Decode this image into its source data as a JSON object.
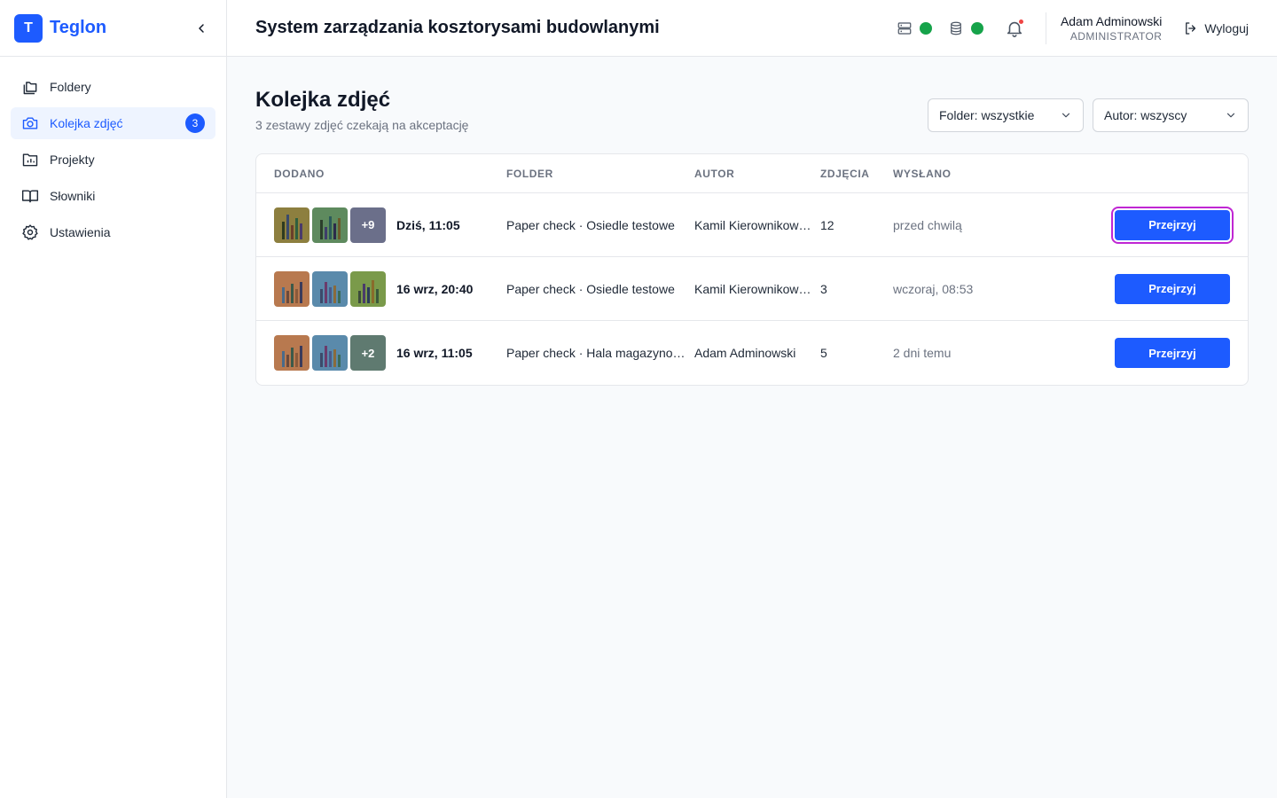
{
  "brand": {
    "logo_letter": "T",
    "name": "Teglon"
  },
  "nav": [
    {
      "label": "Foldery",
      "icon": "folders-icon",
      "active": false
    },
    {
      "label": "Kolejka zdjęć",
      "icon": "camera-icon",
      "active": true,
      "badge": "3"
    },
    {
      "label": "Projekty",
      "icon": "folder-chart-icon",
      "active": false
    },
    {
      "label": "Słowniki",
      "icon": "book-icon",
      "active": false
    },
    {
      "label": "Ustawienia",
      "icon": "gear-icon",
      "active": false
    }
  ],
  "header": {
    "title": "System zarządzania kosztorysami budowlanymi",
    "status": [
      {
        "icon": "server-icon",
        "color": "#16a34a"
      },
      {
        "icon": "database-icon",
        "color": "#16a34a"
      }
    ],
    "user": {
      "name": "Adam Adminowski",
      "role": "ADMINISTRATOR"
    },
    "logout_label": "Wyloguj"
  },
  "page": {
    "title": "Kolejka zdjęć",
    "subtitle": "3 zestawy zdjęć czekają na akceptację",
    "filters": {
      "folder": "Folder: wszystkie",
      "author": "Autor: wszyscy"
    }
  },
  "table": {
    "headers": {
      "added": "DODANO",
      "folder": "FOLDER",
      "author": "AUTOR",
      "photos": "ZDJĘCIA",
      "sent": "WYSŁANO"
    },
    "rows": [
      {
        "date": "Dziś, 11:05",
        "folder": "Paper check · Osiedle testowe",
        "author": "Kamil Kierownikowski",
        "photos": "12",
        "sent": "przed chwilą",
        "more": "+9",
        "button": "Przejrzyj"
      },
      {
        "date": "16 wrz, 20:40",
        "folder": "Paper check · Osiedle testowe",
        "author": "Kamil Kierownikowski",
        "photos": "3",
        "sent": "wczoraj, 08:53",
        "more": "",
        "button": "Przejrzyj"
      },
      {
        "date": "16 wrz, 11:05",
        "folder": "Paper check · Hala magazynowa",
        "author": "Adam Adminowski",
        "photos": "5",
        "sent": "2 dni temu",
        "more": "+2",
        "button": "Przejrzyj"
      }
    ]
  },
  "colors": {
    "accent": "#1d5bff",
    "status_ok": "#16a34a",
    "focus_ring": "#c026d3"
  }
}
